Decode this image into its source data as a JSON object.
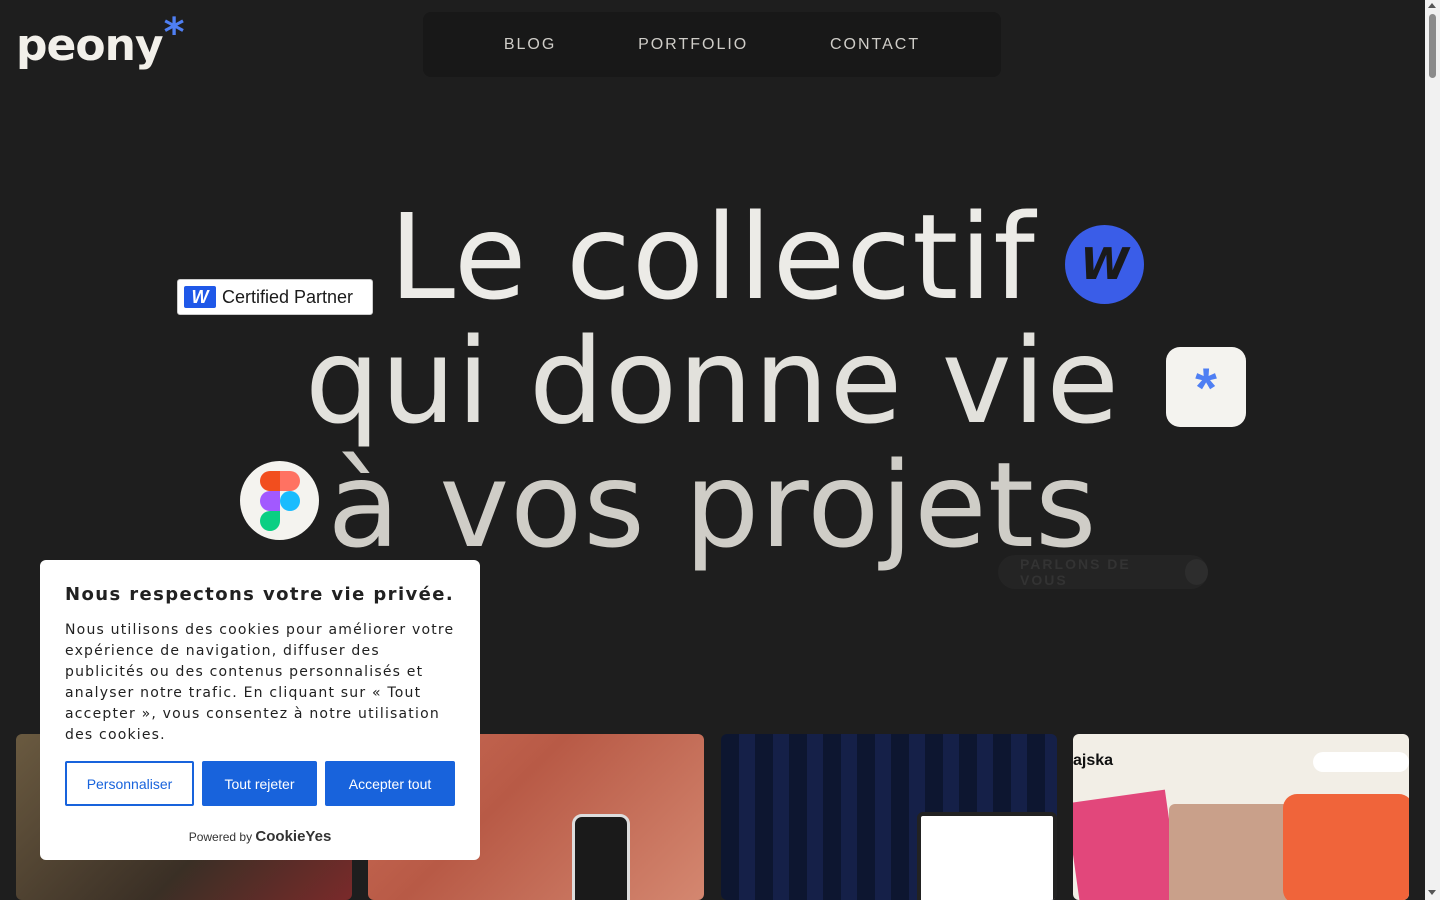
{
  "logo": {
    "text": "peony",
    "star": "*"
  },
  "nav": {
    "items": [
      "BLOG",
      "PORTFOLIO",
      "CONTACT"
    ]
  },
  "hero": {
    "line1": "Le collectif",
    "line2": "qui donne vie",
    "line3": "à vos projets"
  },
  "badge": {
    "mark": "W",
    "text": "Certified Partner"
  },
  "icons": {
    "webflow": "W",
    "asterisk": "*",
    "figma": "figma-icon"
  },
  "cta": {
    "label": "PARLONS DE VOUS"
  },
  "cards": {
    "card4_title": "ajska"
  },
  "cookie": {
    "title": "Nous respectons votre vie privée.",
    "body": "Nous utilisons des cookies pour améliorer votre expérience de navigation, diffuser des publicités ou des contenus personnalisés et analyser notre trafic. En cliquant sur « Tout accepter », vous consentez à notre utilisation des cookies.",
    "customize": "Personnaliser",
    "reject": "Tout rejeter",
    "accept": "Accepter tout",
    "powered_by": "Powered by",
    "brand": "CookieYes"
  },
  "colors": {
    "accent": "#4f7ff3",
    "primary_button": "#1863dc",
    "background": "#1e1e1e"
  }
}
